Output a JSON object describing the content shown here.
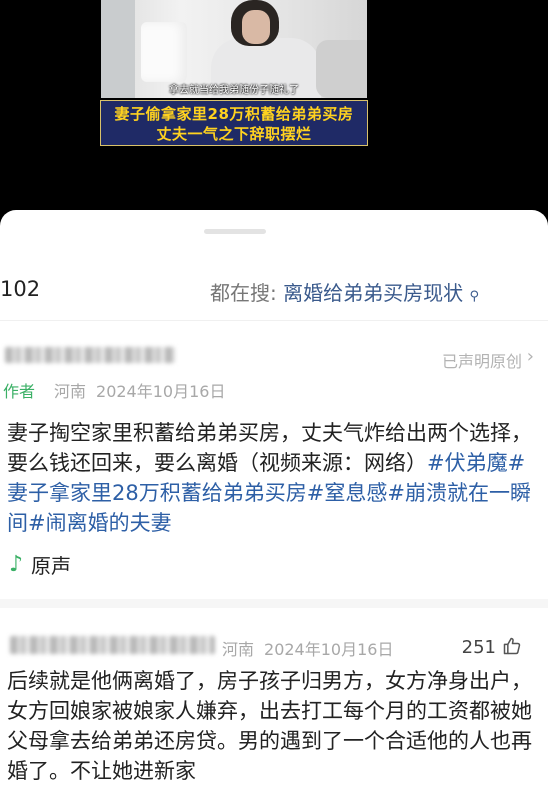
{
  "video": {
    "subtitle": "拿去就当给我弟随份子随礼了",
    "caption_line1": "妻子偷拿家里28万积蓄给弟弟买房",
    "caption_line2": "丈夫一气之下辞职摆烂"
  },
  "comments_header": {
    "count": "102",
    "also_search_label": "都在搜:",
    "also_search_keyword": "离婚给弟弟买房现状",
    "search_icon": "search-icon"
  },
  "post": {
    "declared_original": "已声明原创",
    "author_tag": "作者",
    "location": "河南",
    "date": "2024年10月16日",
    "text": "妻子掏空家里积蓄给弟弟买房，丈夫气炸给出两个选择，要么钱还回来，要么离婚（视频来源：网络）",
    "hashtags": [
      "#伏弟魔",
      "#妻子拿家里28万积蓄给弟弟买房",
      "#窒息感",
      "#崩溃就在一瞬间",
      "#闹离婚的夫妻"
    ],
    "audio_label": "原声",
    "audio_icon": "music-note-icon"
  },
  "comment": {
    "location": "河南",
    "date": "2024年10月16日",
    "likes": "251",
    "like_icon": "thumbs-up-icon",
    "text": "后续就是他俩离婚了，房子孩子归男方，女方净身出户，女方回娘家被娘家人嫌弃，出去打工每个月的工资都被她父母拿去给弟弟还房贷。男的遇到了一个合适他的人也再婚了。不让她进新家"
  },
  "colors": {
    "caption_bg": "#1f2a66",
    "caption_text": "#ffd21f",
    "author_green": "#3bb066",
    "hashtag_blue": "#2d5fa6",
    "keyword_blue": "#3a5a8c"
  }
}
